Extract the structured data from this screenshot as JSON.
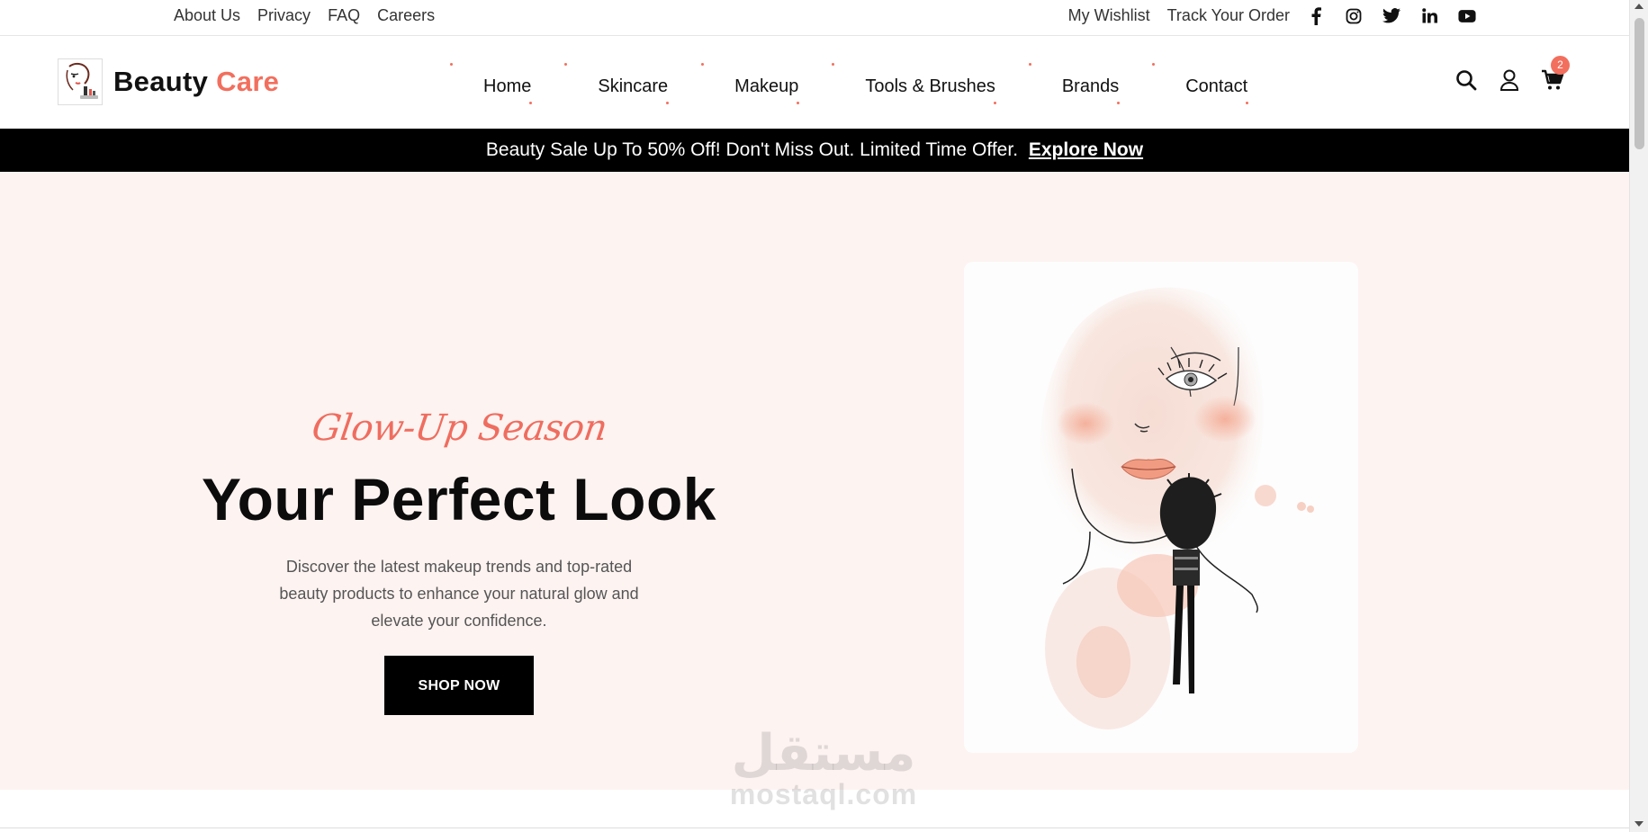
{
  "topbar": {
    "left_links": [
      "About Us",
      "Privacy",
      "FAQ",
      "Careers"
    ],
    "wishlist": "My Wishlist",
    "track_order": "Track Your Order",
    "social_icons": [
      "facebook-icon",
      "instagram-icon",
      "twitter-icon",
      "linkedin-icon",
      "youtube-icon"
    ]
  },
  "brand": {
    "name_part1": "Beauty",
    "name_part2": "Care",
    "accent_color": "#f26f5e"
  },
  "nav": {
    "items": [
      "Home",
      "Skincare",
      "Makeup",
      "Tools & Brushes",
      "Brands",
      "Contact"
    ]
  },
  "header_icons": {
    "search": "search-icon",
    "account": "user-icon",
    "cart": "cart-icon",
    "cart_count": "2"
  },
  "promo": {
    "text": "Beauty Sale Up To 50% Off! Don't Miss Out. Limited Time Offer.",
    "cta": "Explore Now"
  },
  "hero": {
    "script_title": "Glow-Up Season",
    "title": "Your Perfect Look",
    "description": "Discover the latest makeup trends and top-rated beauty products to enhance your natural glow and elevate your confidence.",
    "button": "SHOP NOW",
    "background_color": "#fdf3f1"
  },
  "watermark": {
    "arabic": "مستقل",
    "latin": "mostaql.com"
  }
}
